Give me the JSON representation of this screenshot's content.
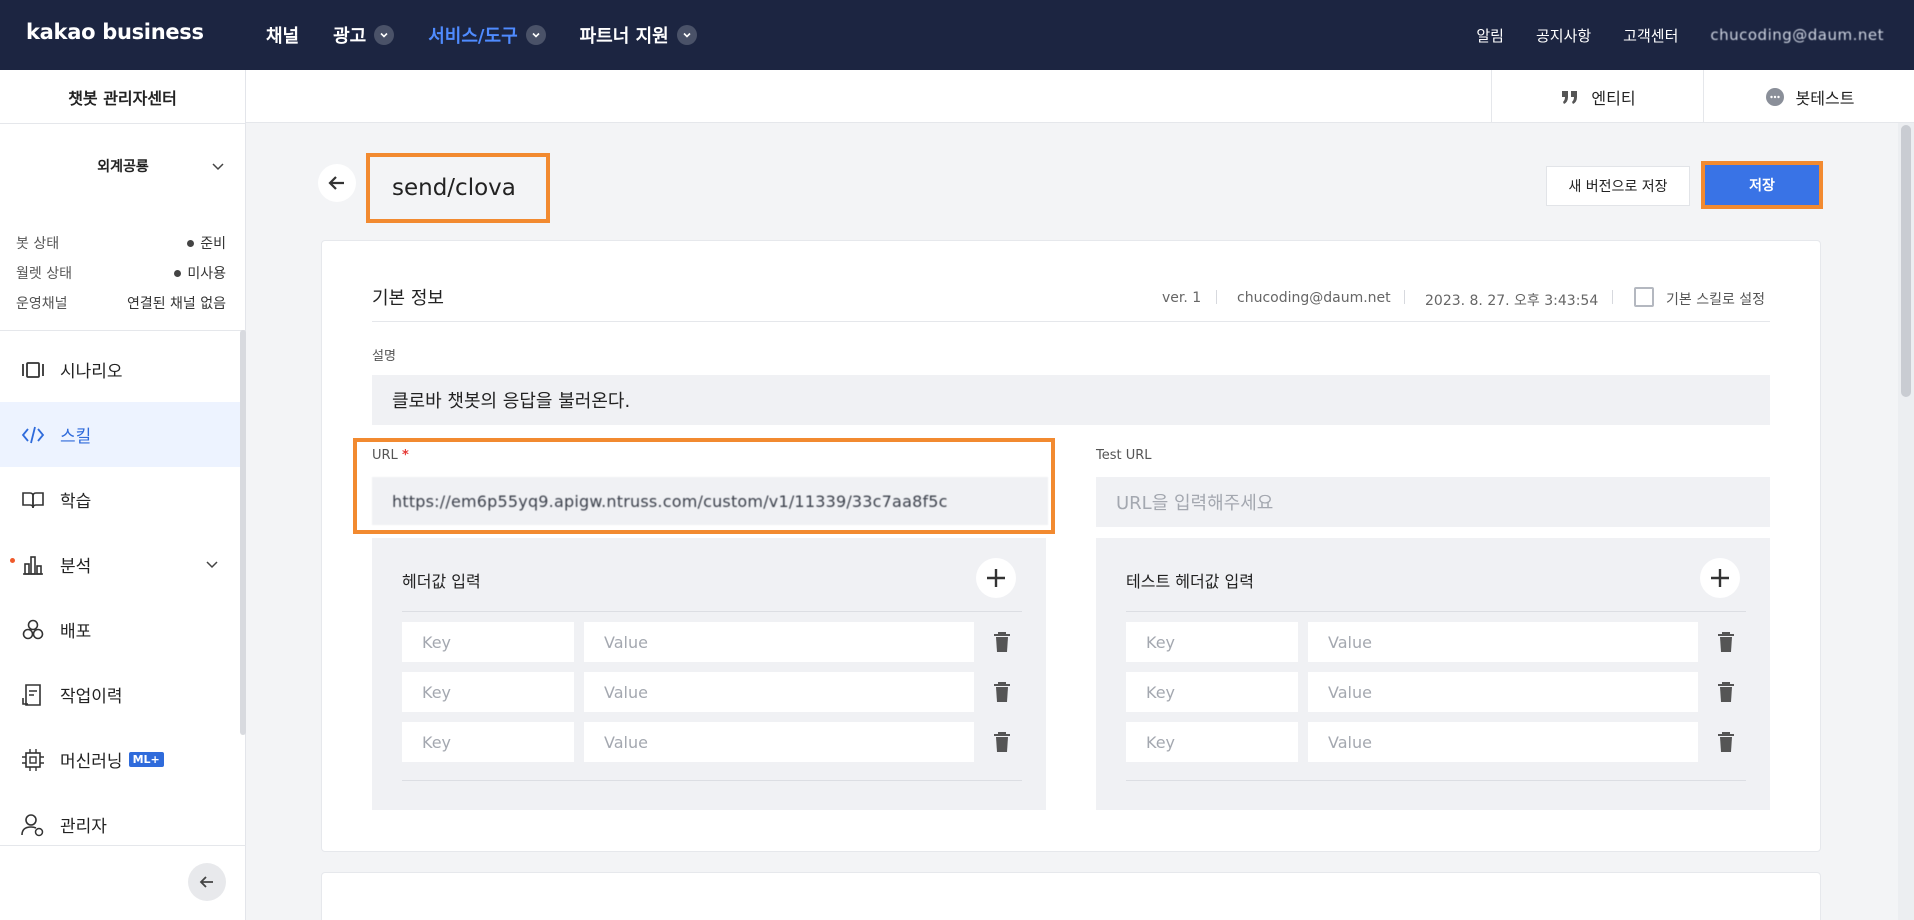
{
  "topnav": {
    "logo": "kakao business",
    "items": [
      {
        "label": "채널",
        "dropdown": false,
        "active": false
      },
      {
        "label": "광고",
        "dropdown": true,
        "active": false
      },
      {
        "label": "서비스/도구",
        "dropdown": true,
        "active": true
      },
      {
        "label": "파트너 지원",
        "dropdown": true,
        "active": false
      }
    ],
    "right": {
      "alerts": "알림",
      "notices": "공지사항",
      "support": "고객센터",
      "user": "chucoding@daum.net"
    }
  },
  "sidebar": {
    "title": "챗봇 관리자센터",
    "bot_name": "외계공룡",
    "status": [
      {
        "key": "봇 상태",
        "value": "준비"
      },
      {
        "key": "월렛 상태",
        "value": "미사용"
      },
      {
        "key": "운영채널",
        "value": "연결된 채널 없음"
      }
    ],
    "menu": [
      {
        "label": "시나리오",
        "icon": "scenario-icon"
      },
      {
        "label": "스킬",
        "icon": "code-icon",
        "active": true
      },
      {
        "label": "학습",
        "icon": "book-icon"
      },
      {
        "label": "분석",
        "icon": "chart-icon"
      },
      {
        "label": "배포",
        "icon": "deploy-icon"
      },
      {
        "label": "작업이력",
        "icon": "history-icon"
      },
      {
        "label": "머신러닝",
        "icon": "chip-icon",
        "badge": "ML+"
      },
      {
        "label": "관리자",
        "icon": "admin-icon"
      }
    ]
  },
  "subheader": {
    "entity": "엔티티",
    "bot_test": "봇테스트"
  },
  "skill": {
    "title": "send/clova",
    "new_version_btn": "새 버전으로 저장",
    "save_btn": "저장"
  },
  "basic_info": {
    "title": "기본 정보",
    "version": "ver. 1",
    "author": "chucoding@daum.net",
    "modified": "2023. 8. 27. 오후 3:43:54",
    "default_skill_label": "기본 스킬로 설정",
    "desc_label": "설명",
    "desc_value": "클로바 챗봇의 응답을 불러온다.",
    "url_label": "URL",
    "url_value": "https://em6p55yq9.apigw.ntruss.com/custom/v1/11339/33c7aa8f5c",
    "test_url_label": "Test URL",
    "test_url_placeholder": "URL을 입력해주세요"
  },
  "headers": {
    "title": "헤더값 입력",
    "test_title": "테스트 헤더값 입력",
    "key_placeholder": "Key",
    "value_placeholder": "Value"
  },
  "colors": {
    "nav_bg": "#1c2541",
    "accent": "#3973e6",
    "highlight": "#f28a30"
  }
}
